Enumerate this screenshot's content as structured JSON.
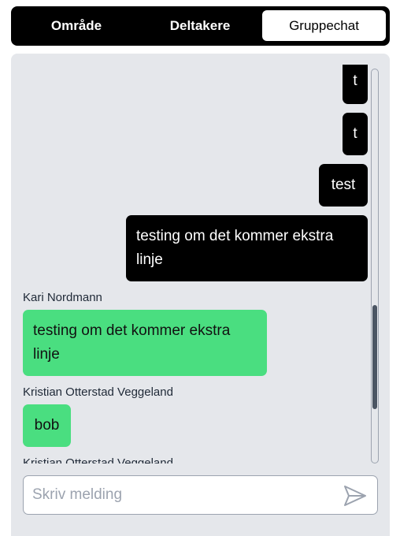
{
  "tabs": [
    {
      "label": "Område",
      "active": false
    },
    {
      "label": "Deltakere",
      "active": false
    },
    {
      "label": "Gruppechat",
      "active": true
    }
  ],
  "messages": [
    {
      "from": "me",
      "text": "t"
    },
    {
      "from": "me",
      "text": "t"
    },
    {
      "from": "me",
      "text": "test"
    },
    {
      "from": "me",
      "text": "testing om det kommer ekstra linje"
    },
    {
      "from": "other",
      "sender": "Kari Nordmann",
      "text": "testing om det kommer ekstra linje"
    },
    {
      "from": "other",
      "sender": "Kristian Otterstad Veggeland",
      "text": "bob"
    },
    {
      "from": "other",
      "sender": "Kristian Otterstad Veggeland",
      "text": ""
    }
  ],
  "composer": {
    "placeholder": "Skriv melding",
    "value": ""
  },
  "icons": {
    "send": "send-icon"
  },
  "colors": {
    "own_bubble": "#000000",
    "other_bubble": "#4ade80",
    "panel_bg": "#e5e7eb",
    "tab_bar": "#000000"
  }
}
